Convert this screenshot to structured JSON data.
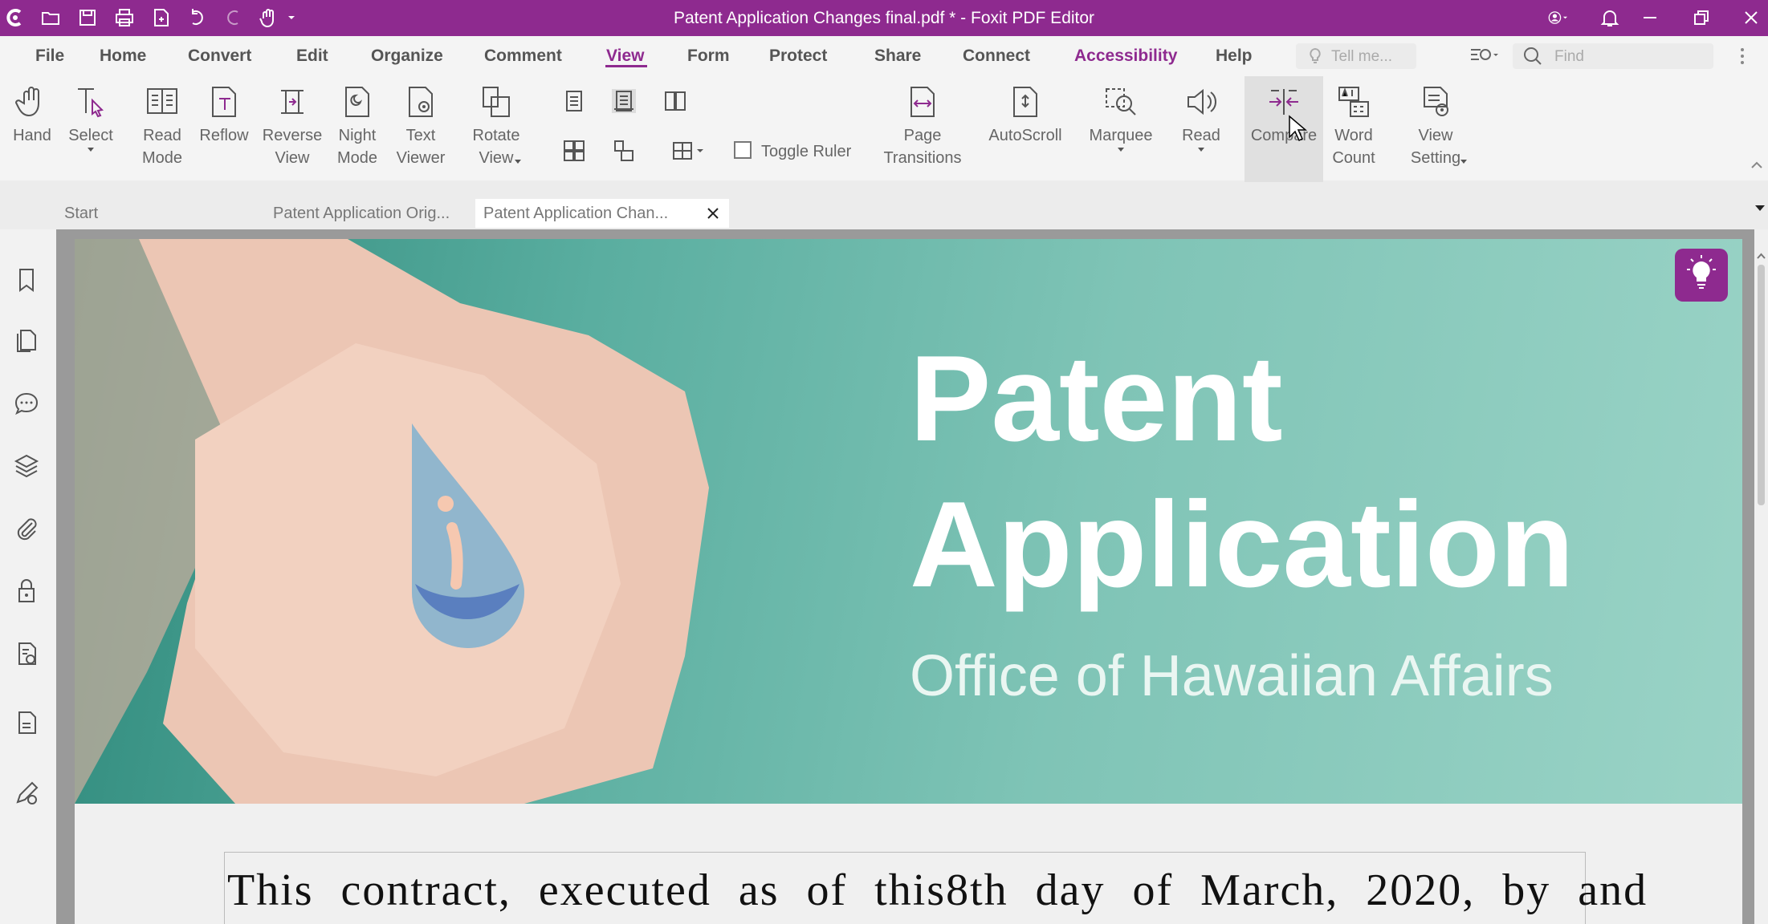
{
  "window": {
    "title": "Patent Application Changes final.pdf * - Foxit PDF Editor",
    "accent_color": "#8e2a8f"
  },
  "quick_access": [
    "foxit-logo-icon",
    "open-folder-icon",
    "save-icon",
    "print-icon",
    "new-document-icon",
    "undo-icon",
    "redo-icon",
    "hand-tool-icon",
    "customize-dropdown-icon"
  ],
  "menu": {
    "items": [
      "File",
      "Home",
      "Convert",
      "Edit",
      "Organize",
      "Comment",
      "View",
      "Form",
      "Protect",
      "Share",
      "Connect",
      "Accessibility",
      "Help"
    ],
    "active": "View",
    "tell_me_placeholder": "Tell me...",
    "find_placeholder": "Find"
  },
  "ribbon": {
    "hand": "Hand",
    "select": "Select",
    "read_mode": "Read\nMode",
    "reflow": "Reflow",
    "reverse_view": "Reverse\nView",
    "night_mode": "Night\nMode",
    "text_viewer": "Text\nViewer",
    "rotate_view": "Rotate\nView",
    "toggle_ruler": "Toggle Ruler",
    "page_transitions": "Page\nTransitions",
    "autoscroll": "AutoScroll",
    "marquee": "Marquee",
    "read": "Read",
    "compare": "Compare",
    "word_count": "Word\nCount",
    "view_setting": "View\nSetting"
  },
  "tabs": {
    "start": "Start",
    "original": "Patent Application Orig...",
    "changes": "Patent Application Chan..."
  },
  "sidebar_icons": [
    "bookmark-icon",
    "pages-icon",
    "comments-icon",
    "layers-icon",
    "attachments-icon",
    "security-icon",
    "signature-icon",
    "document-icon",
    "edit-sign-icon"
  ],
  "document": {
    "hero_title_line1": "Patent",
    "hero_title_line2": "Application",
    "hero_subtitle": "Office of Hawaiian Affairs",
    "body_line": "This contract, executed as of this8th day of March, 2020, by and"
  }
}
